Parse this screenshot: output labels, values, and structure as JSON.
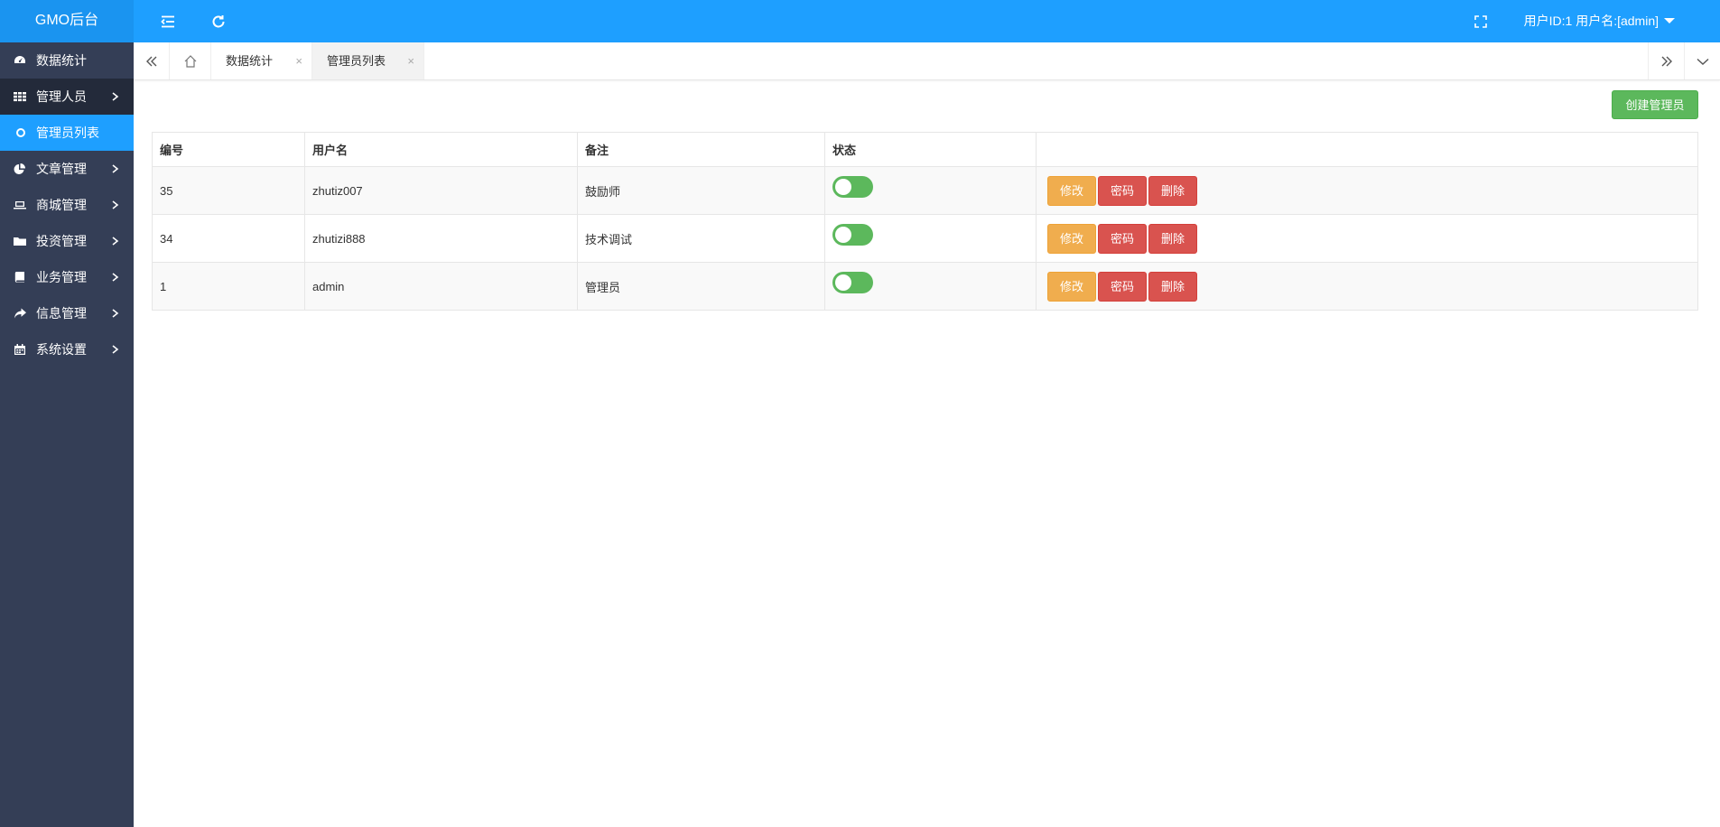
{
  "app": {
    "title": "GMO后台"
  },
  "header": {
    "user_label": "用户ID:1 用户名:[admin]"
  },
  "sidebar": {
    "items": [
      {
        "label": "数据统计",
        "icon": "dashboard-icon"
      },
      {
        "label": "管理人员",
        "icon": "grid-icon"
      },
      {
        "label": "管理员列表",
        "icon": "circle-icon"
      },
      {
        "label": "文章管理",
        "icon": "pie-chart-icon"
      },
      {
        "label": "商城管理",
        "icon": "laptop-icon"
      },
      {
        "label": "投资管理",
        "icon": "folder-icon"
      },
      {
        "label": "业务管理",
        "icon": "book-icon"
      },
      {
        "label": "信息管理",
        "icon": "share-icon"
      },
      {
        "label": "系统设置",
        "icon": "calendar-icon"
      }
    ]
  },
  "tabs": [
    {
      "label": "数据统计",
      "close": "×"
    },
    {
      "label": "管理员列表",
      "close": "×"
    }
  ],
  "toolbar": {
    "create_label": "创建管理员"
  },
  "table": {
    "headers": [
      "编号",
      "用户名",
      "备注",
      "状态",
      ""
    ],
    "rows": [
      {
        "id": "35",
        "username": "zhutiz007",
        "remark": "鼓励师",
        "enabled": true
      },
      {
        "id": "34",
        "username": "zhutizi888",
        "remark": "技术调试",
        "enabled": true
      },
      {
        "id": "1",
        "username": "admin",
        "remark": "管理员",
        "enabled": true
      }
    ],
    "actions": {
      "edit": "修改",
      "password": "密码",
      "delete": "删除"
    }
  },
  "colors": {
    "header_bg": "#1e9fff",
    "sidebar_bg": "#343e56",
    "success": "#5cb85c",
    "warning": "#f0ad4e",
    "danger": "#d9534f"
  }
}
